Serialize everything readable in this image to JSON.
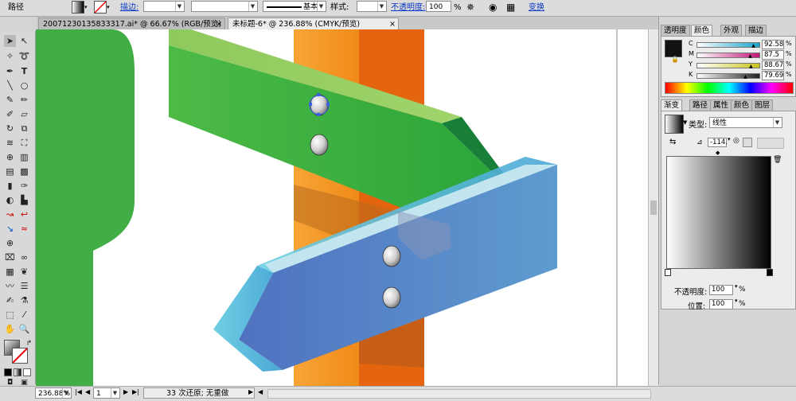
{
  "control_bar": {
    "object_type": "路径",
    "stroke_label": "描边:",
    "stroke_weight": "",
    "brush_style": "基本",
    "style_label": "样式:",
    "opacity_label": "不透明度:",
    "opacity_value": "100",
    "percent": "%",
    "transform_label": "变换"
  },
  "tabs": [
    {
      "label": "20071230135833317.ai* @ 66.67% (RGB/预览)",
      "active": false
    },
    {
      "label": "未标题-6* @ 236.88% (CMYK/预览)",
      "active": true
    }
  ],
  "color_panel": {
    "tabs": [
      "透明度",
      "颜色",
      "外观",
      "描边"
    ],
    "active_tab": "颜色",
    "channels": [
      {
        "label": "C",
        "value": "92.58",
        "level": 92.58
      },
      {
        "label": "M",
        "value": "87.5",
        "level": 87.5
      },
      {
        "label": "Y",
        "value": "88.67",
        "level": 88.67
      },
      {
        "label": "K",
        "value": "79.69",
        "level": 79.69
      }
    ],
    "percent": "%"
  },
  "gradient_panel": {
    "tabs": [
      "渐变",
      "路径",
      "属性",
      "颜色",
      "图层"
    ],
    "active_tab": "渐变",
    "type_label": "类型:",
    "type_value": "线性",
    "angle_value": "-114.",
    "opacity_label": "不透明度:",
    "opacity_value": "100",
    "location_label": "位置:",
    "location_value": "100",
    "percent": "%"
  },
  "status_bar": {
    "zoom": "236.88%",
    "page": "1",
    "history": "33 次还原; 无重做"
  },
  "colors": {
    "green_sign": "#3fae3c",
    "green_sign_top": "#8cc55a",
    "blue_sign": "#5a84c4",
    "blue_sign_top": "#bfe3ef",
    "post_orange": "#f59a2a",
    "post_dark": "#e26a10",
    "left_green": "#40ad45"
  }
}
